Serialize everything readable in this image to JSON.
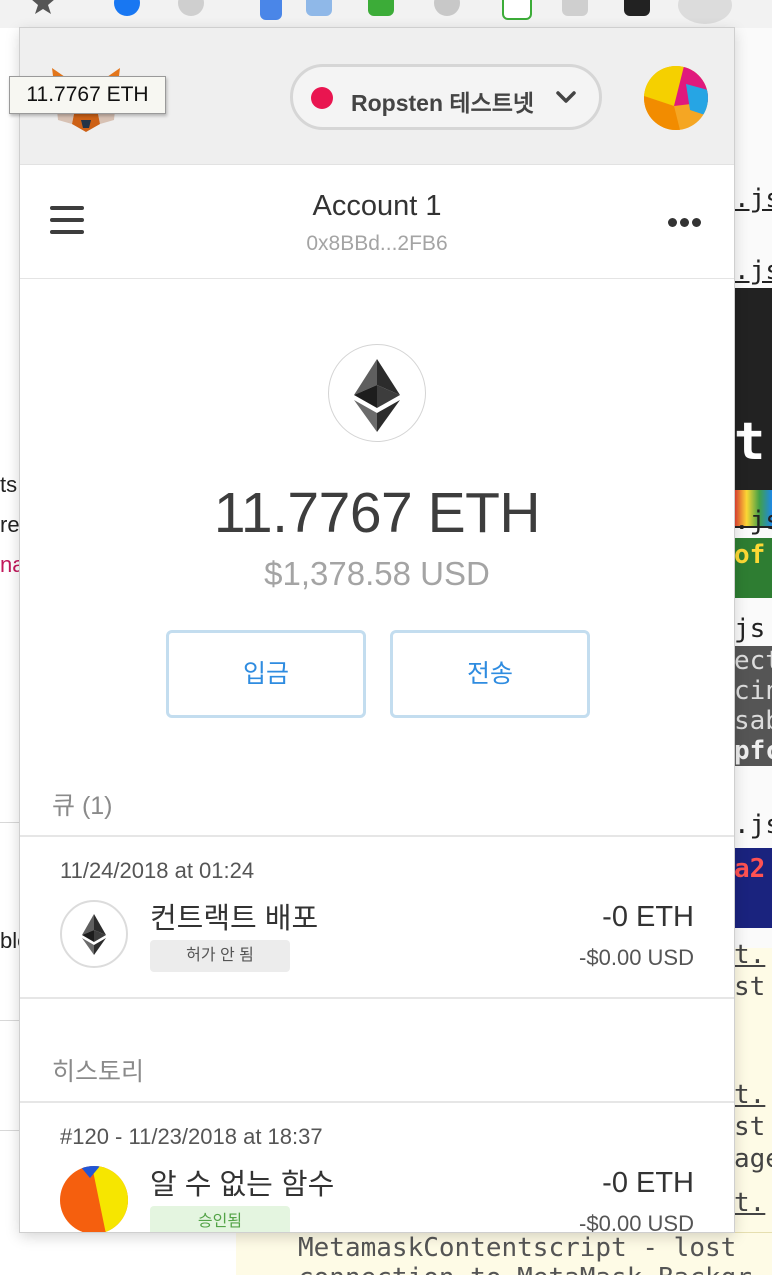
{
  "tooltip": {
    "text": "11.7767 ETH"
  },
  "header": {
    "network": {
      "label": "Ropsten 테스트넷",
      "dot_color": "#e91550"
    }
  },
  "account": {
    "name": "Account 1",
    "address": "0x8BBd...2FB6"
  },
  "balance": {
    "primary_value": "11.7767",
    "primary_unit": "ETH",
    "secondary": "$1,378.58 USD"
  },
  "actions": {
    "deposit_label": "입금",
    "send_label": "전송"
  },
  "queue": {
    "title": "큐 (1)",
    "items": [
      {
        "date": "11/24/2018 at 01:24",
        "title": "컨트랙트 배포",
        "status": "허가 안 됨",
        "amount": "-0 ETH",
        "fiat": "-$0.00 USD",
        "icon": "eth-icon"
      }
    ]
  },
  "history": {
    "title": "히스토리",
    "items": [
      {
        "date": "#120 - 11/23/2018 at 18:37",
        "title": "알 수 없는 함수",
        "status": "승인됨",
        "amount": "-0 ETH",
        "fiat": "-$0.00 USD",
        "icon": "jazzicon"
      }
    ]
  },
  "background": {
    "left_fragments": [
      "ts",
      "re",
      "na",
      "ble"
    ],
    "right_code": [
      ".js",
      ".js",
      "t",
      ".js",
      "of",
      "js",
      "ect",
      "cin",
      "sab",
      "pfc",
      ".js",
      "a2",
      "t.",
      "st",
      "t.",
      "st",
      "age",
      "t."
    ],
    "bottom_lines": [
      "MetamaskContentscript - lost",
      "connection to MetaMask Backgr"
    ]
  },
  "colors": {
    "accent": "#2f8ce0",
    "button_border": "#c3ddef",
    "badge_unapproved_bg": "#ececec",
    "badge_confirmed_bg": "#e4f5e0",
    "badge_confirmed_text": "#53a347"
  }
}
